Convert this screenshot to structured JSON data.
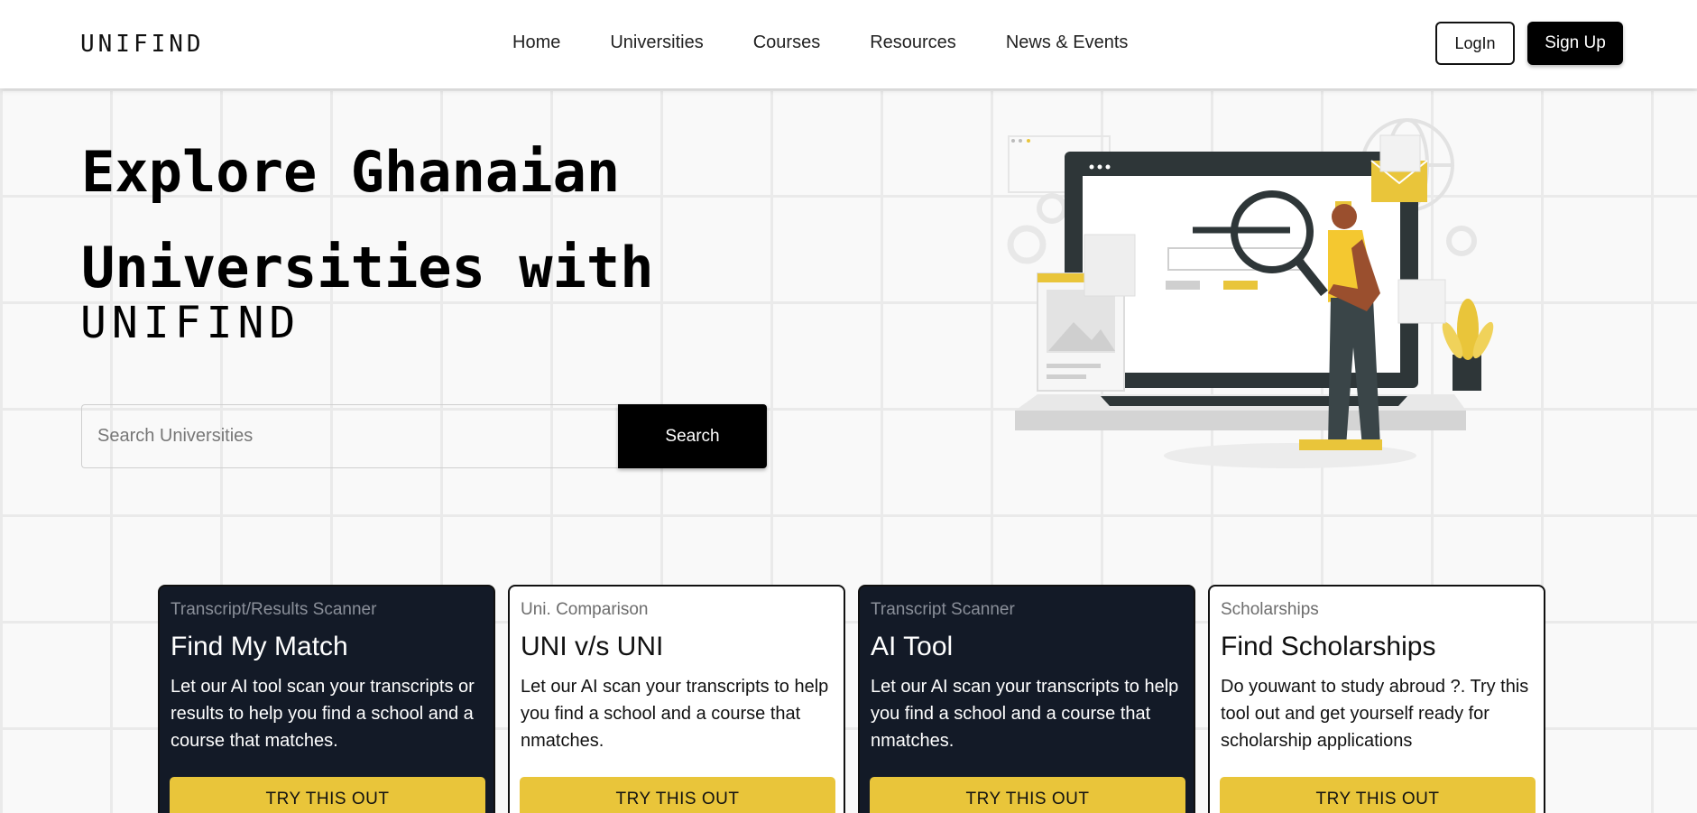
{
  "header": {
    "logo": "UNIFIND",
    "nav": [
      "Home",
      "Universities",
      "Courses",
      "Resources",
      "News & Events"
    ],
    "login_label": "LogIn",
    "signup_label": "Sign Up"
  },
  "hero": {
    "title_line1": "Explore Ghanaian",
    "title_line2": "Universities with",
    "logo": "UNIFIND",
    "search_placeholder": "Search Universities",
    "search_button": "Search"
  },
  "cards": [
    {
      "kicker": "Transcript/Results Scanner",
      "title": "Find My Match",
      "description": "Let our AI tool scan your transcripts or results to help you find a school and a course that matches.",
      "button": "TRY THIS OUT"
    },
    {
      "kicker": "Uni. Comparison",
      "title": "UNI v/s UNI",
      "description": "Let our AI scan your transcripts to help you find a school and a course that nmatches.",
      "button": "TRY THIS OUT"
    },
    {
      "kicker": "Transcript Scanner",
      "title": "AI Tool",
      "description": "Let our AI scan your transcripts to help you find a school and a course that nmatches.",
      "button": "TRY THIS OUT"
    },
    {
      "kicker": "Scholarships",
      "title": "Find Scholarships",
      "description": "Do youwant to study abroud ?. Try this tool out and get yourself ready for scholarship applications",
      "button": "TRY THIS OUT"
    }
  ],
  "colors": {
    "accent": "#e9c53a",
    "dark_card": "#131a27",
    "primary": "#000000"
  }
}
